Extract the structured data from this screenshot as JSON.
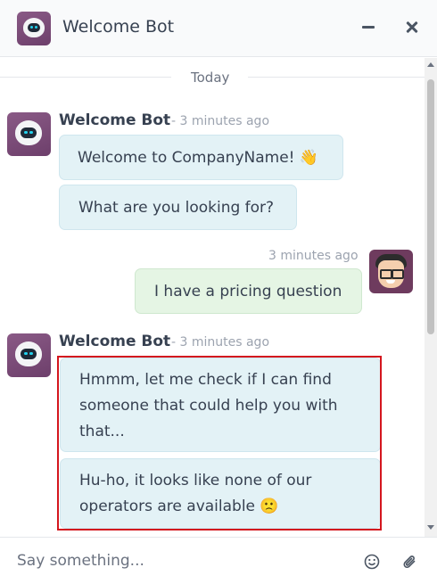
{
  "header": {
    "title": "Welcome Bot"
  },
  "thread": {
    "day_label": "Today",
    "messages": [
      {
        "author": "Welcome Bot",
        "time": "- 3 minutes ago",
        "texts": [
          "Welcome to CompanyName! 👋",
          "What are you looking for?"
        ]
      },
      {
        "author": "",
        "time": "3 minutes ago",
        "texts": [
          "I have a pricing question"
        ]
      },
      {
        "author": "Welcome Bot",
        "time": "- 3 minutes ago",
        "texts": [
          "Hmmm, let me check if I can find someone that could help you with that...",
          "Hu-ho, it looks like none of our operators are available 🙁"
        ]
      }
    ]
  },
  "composer": {
    "placeholder": "Say something..."
  },
  "icons": {
    "header_avatar": "bot-avatar-icon",
    "minimize": "minimize-icon",
    "close": "close-icon",
    "user_avatar": "user-avatar-icon",
    "emoji": "smiley-icon",
    "attach": "paperclip-icon"
  },
  "colors": {
    "bot_bubble": "#e3f2f6",
    "user_bubble": "#e5f5e4",
    "highlight_border": "#d4161e",
    "header_bg": "#f9fafb"
  }
}
